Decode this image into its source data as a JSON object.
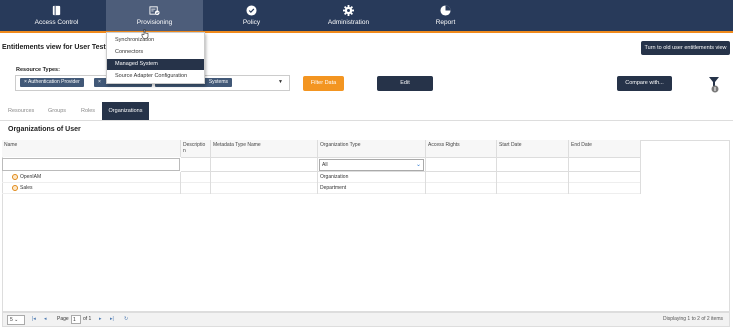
{
  "nav": {
    "items": [
      {
        "label": "Access Control",
        "icon": "book-icon"
      },
      {
        "label": "Provisioning",
        "icon": "provisioning-icon",
        "active": true
      },
      {
        "label": "Policy",
        "icon": "check-circle-icon"
      },
      {
        "label": "Administration",
        "icon": "gear-icon"
      },
      {
        "label": "Report",
        "icon": "pie-chart-icon"
      }
    ]
  },
  "provisioning_menu": {
    "items": [
      "Synchronization",
      "Connectors",
      "Managed System",
      "Source Adapter Configuration"
    ],
    "highlighted": "Managed System"
  },
  "page": {
    "title": "Entitlements view for User Test U",
    "old_view_button": "Turn to old user entitlements view",
    "resource_types_label": "Resource Types:",
    "chips": [
      "× Authentication Provider",
      "×",
      "Systems"
    ],
    "filter_button": "Filter Data",
    "edit_button": "Edit",
    "compare_button": "Compare with..."
  },
  "tabs": [
    "Resources",
    "Groups",
    "Roles",
    "Organizations"
  ],
  "active_tab": "Organizations",
  "section_title": "Organizations of User",
  "table": {
    "columns": [
      "Name",
      "Descriptio n",
      "Metadata Type Name",
      "Organization Type",
      "Access Rights",
      "Start Date",
      "End Date"
    ],
    "org_type_filter": "All",
    "rows": [
      {
        "name": "OpenIAM",
        "org_type": "Organization"
      },
      {
        "name": "Sales",
        "org_type": "Department"
      }
    ]
  },
  "pager": {
    "page_size": "5",
    "page_label": "Page",
    "page_value": "1",
    "of_label": "of 1",
    "display_text": "Displaying 1 to 2 of 2 items"
  },
  "colors": {
    "topbar": "#283a5a",
    "accent": "#f08a1c",
    "dark_button": "#263349",
    "orange_button": "#f39521"
  }
}
